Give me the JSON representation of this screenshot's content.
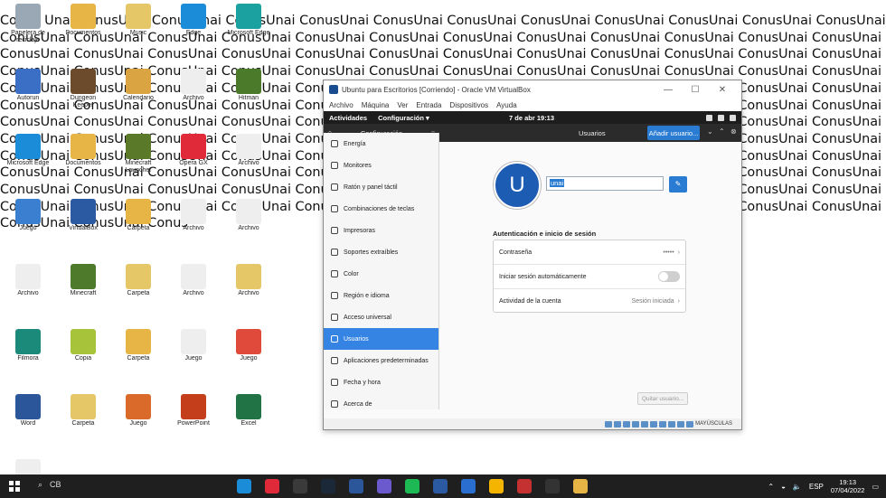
{
  "wallpaper_text": "Conus Unai ConusUnai ConusUnai ConusUnai ConusUnai ConusUnai ConusUnai ConusUnai ConusUnai ConusUnai ConusUnai ConusUnai ConusUnai ConusUnai ConusUnai ConusUnai ConusUnai ConusUnai ConusUnai ConusUnai ConusUnai ConusUnai ConusUnai ConusUnai ConusUnai ConusUnai ConusUnai ConusUnai ConusUnai ConusUnai ConusUnai ConusUnai ConusUnai ConusUnai ConusUnai ConusUnai ConusUnai ConusUnai ConusUnai ConusUnai ConusUnai ConusUnai ConusUnai ConusUnai ConusUnai ConusUnai ConusUnai ConusUnai ConusUnai ConusUnai ConusUnai ConusUnai ConusUnai ConusUnai ConusUnai ConusUnai ConusUnai ConusUnai ConusUnai ConusUnai ConusUnai ConusUnai ConusUnai ConusUnai ConusUnai ConusUnai ConusUnai ConusUnai ConusUnai ConusUnai ConusUnai ConusUnai ConusUnai ConusUnai ConusUnai ConusUnai ConusUnai ConusUnai ConusUnai ConusUnai ConusUnai ConusUnai ConusUnai ConusUnai ConusUnai ConusUnai ConusUnai ConusUnai ConusUnai ConusUnai ConusUnai ConusUnai ConusUnai ConusUnai ConusUnai ConusUnai ConusUnai ConusUnai ConusUnai ConusUnai ConusUnai ConusUnai ConusUnai ConusUnai ConusUnai ConusUnai ConusUnai ConusUnai ConusUnai ConusUnai ConusUnai ConusUnai ConusUnai ConusUnai ConusUnai ConusUnai ConusUnai ConusUnai ConusUnai ConusUnai ConusUnai ConusUnai ConusUnai ConusUnai ConusUnai ConusUnai ConusUnai ConusUnai ConusUnai ConusUnai ConusUnai ConusUnai ConusUnai ConusUnai ConusUnai ConusUnai ConusUnai ConusUnai ConusUnai ConusUnai ConusUnai ConusUnai ConusUnai ConusUnai ConusUnai ConusUnai Conus",
  "desktop_icons": [
    {
      "label": "Papelera de reciclaje",
      "icon": "recycle-bin-icon",
      "color": "#9aa7b5"
    },
    {
      "label": "Documentos",
      "icon": "folder-icon",
      "color": "#e6b545"
    },
    {
      "label": "Music",
      "icon": "folder-icon",
      "color": "#e6c768"
    },
    {
      "label": "Edge",
      "icon": "edge-icon",
      "color": "#1b8cd8"
    },
    {
      "label": "Microsoft Edge",
      "icon": "edge-icon",
      "color": "#1ba1a0"
    },
    {
      "label": "Autorun",
      "icon": "shield-icon",
      "color": "#3b6fc6"
    },
    {
      "label": "Dungeon Keeper",
      "icon": "game-icon",
      "color": "#6b4b2b"
    },
    {
      "label": "Calendario",
      "icon": "app-icon",
      "color": "#d9a441"
    },
    {
      "label": "Archivo",
      "icon": "file-icon",
      "color": "#eeeeee"
    },
    {
      "label": "Hitman",
      "icon": "game-icon",
      "color": "#4a7a2a"
    },
    {
      "label": "Microsoft Edge",
      "icon": "edge-icon",
      "color": "#1b8cd8"
    },
    {
      "label": "Documentos",
      "icon": "folder-icon",
      "color": "#e6b545"
    },
    {
      "label": "Minecraft Launcher",
      "icon": "app-icon",
      "color": "#5a7a2a"
    },
    {
      "label": "Opera GX",
      "icon": "opera-icon",
      "color": "#e02a3a"
    },
    {
      "label": "Archivo",
      "icon": "file-icon",
      "color": "#eeeeee"
    },
    {
      "label": "Juego",
      "icon": "game-icon",
      "color": "#3a7fd0"
    },
    {
      "label": "VirtualBox",
      "icon": "virtualbox-icon",
      "color": "#2b5aa3"
    },
    {
      "label": "Carpeta",
      "icon": "folder-icon",
      "color": "#e6b545"
    },
    {
      "label": "Archivo",
      "icon": "file-icon",
      "color": "#eeeeee"
    },
    {
      "label": "Archivo",
      "icon": "file-icon",
      "color": "#eeeeee"
    },
    {
      "label": "Archivo",
      "icon": "file-icon",
      "color": "#eeeeee"
    },
    {
      "label": "Minecraft",
      "icon": "minecraft-icon",
      "color": "#4e7a2c"
    },
    {
      "label": "Carpeta",
      "icon": "folder-icon",
      "color": "#e6c768"
    },
    {
      "label": "Archivo",
      "icon": "file-icon",
      "color": "#eeeeee"
    },
    {
      "label": "Archivo",
      "icon": "file-icon",
      "color": "#e6c768"
    },
    {
      "label": "Filmora",
      "icon": "filmora-icon",
      "color": "#1c8a7a"
    },
    {
      "label": "Copia",
      "icon": "file-icon",
      "color": "#a6c339"
    },
    {
      "label": "Carpeta",
      "icon": "folder-icon",
      "color": "#e6b545"
    },
    {
      "label": "Juego",
      "icon": "app-icon",
      "color": "#eeeeee"
    },
    {
      "label": "Juego",
      "icon": "game-icon",
      "color": "#e04a3a"
    },
    {
      "label": "Word",
      "icon": "word-icon",
      "color": "#2b579a"
    },
    {
      "label": "Carpeta",
      "icon": "folder-icon",
      "color": "#e6c768"
    },
    {
      "label": "Juego",
      "icon": "game-icon",
      "color": "#d96a2a"
    },
    {
      "label": "PowerPoint",
      "icon": "powerpoint-icon",
      "color": "#c43e1c"
    },
    {
      "label": "Excel",
      "icon": "excel-icon",
      "color": "#217346"
    },
    {
      "label": "Archivo",
      "icon": "file-icon",
      "color": "#eeeeee"
    }
  ],
  "vbox": {
    "title": "Ubuntu para Escritorios [Corriendo] - Oracle VM VirtualBox",
    "menu": [
      "Archivo",
      "Máquina",
      "Ver",
      "Entrada",
      "Dispositivos",
      "Ayuda"
    ],
    "controls": {
      "minimize": "—",
      "maximize": "☐",
      "close": "✕"
    }
  },
  "ubuntu": {
    "topbar": {
      "activities": "Actividades",
      "app": "Configuración ▾",
      "clock": "7 de abr  19:13"
    },
    "header": {
      "title": "Configuración",
      "center": "Usuarios",
      "add_button": "Añadir usuario..."
    },
    "sidebar": [
      {
        "label": "Energía",
        "icon": "power-icon"
      },
      {
        "label": "Monitores",
        "icon": "monitor-icon"
      },
      {
        "label": "Ratón y panel táctil",
        "icon": "mouse-icon"
      },
      {
        "label": "Combinaciones de teclas",
        "icon": "keyboard-icon"
      },
      {
        "label": "Impresoras",
        "icon": "printer-icon"
      },
      {
        "label": "Soportes extraíbles",
        "icon": "media-icon"
      },
      {
        "label": "Color",
        "icon": "color-icon"
      },
      {
        "label": "Región e idioma",
        "icon": "region-icon"
      },
      {
        "label": "Acceso universal",
        "icon": "accessibility-icon"
      },
      {
        "label": "Usuarios",
        "icon": "users-icon"
      },
      {
        "label": "Aplicaciones predeterminadas",
        "icon": "star-icon"
      },
      {
        "label": "Fecha y hora",
        "icon": "clock-icon"
      },
      {
        "label": "Acerca de",
        "icon": "info-icon"
      }
    ],
    "active_sidebar_index": 9,
    "user": {
      "avatar_letter": "U",
      "name": "unai",
      "edit_icon": "✎",
      "section_title": "Autenticación e inicio de sesión",
      "rows": [
        {
          "label": "Contraseña",
          "value": "•••••",
          "type": "link"
        },
        {
          "label": "Iniciar sesión automáticamente",
          "value": "",
          "type": "toggle",
          "on": false
        },
        {
          "label": "Actividad de la cuenta",
          "value": "Sesión iniciada",
          "type": "link"
        }
      ],
      "quit_button": "Quitar usuario..."
    },
    "statusbar": {
      "caps": "MAYÚSCULAS"
    }
  },
  "taskbar": {
    "search": "CB",
    "apps": [
      {
        "icon": "edge-icon",
        "color": "#1b8cd8"
      },
      {
        "icon": "opera-icon",
        "color": "#e02a3a"
      },
      {
        "icon": "app-icon",
        "color": "#3a3a3a"
      },
      {
        "icon": "steam-icon",
        "color": "#1b2838"
      },
      {
        "icon": "word-icon",
        "color": "#2b579a"
      },
      {
        "icon": "app-icon",
        "color": "#6a5acd"
      },
      {
        "icon": "spotify-icon",
        "color": "#1db954"
      },
      {
        "icon": "virtualbox-icon",
        "color": "#2b5aa3"
      },
      {
        "icon": "mail-icon",
        "color": "#2a6fd0"
      },
      {
        "icon": "chrome-icon",
        "color": "#f4b400"
      },
      {
        "icon": "game-icon",
        "color": "#c53030"
      },
      {
        "icon": "epic-icon",
        "color": "#333333"
      },
      {
        "icon": "app-icon",
        "color": "#e6b545"
      }
    ],
    "lang": "ESP",
    "time": "19:13",
    "date": "07/04/2022"
  }
}
